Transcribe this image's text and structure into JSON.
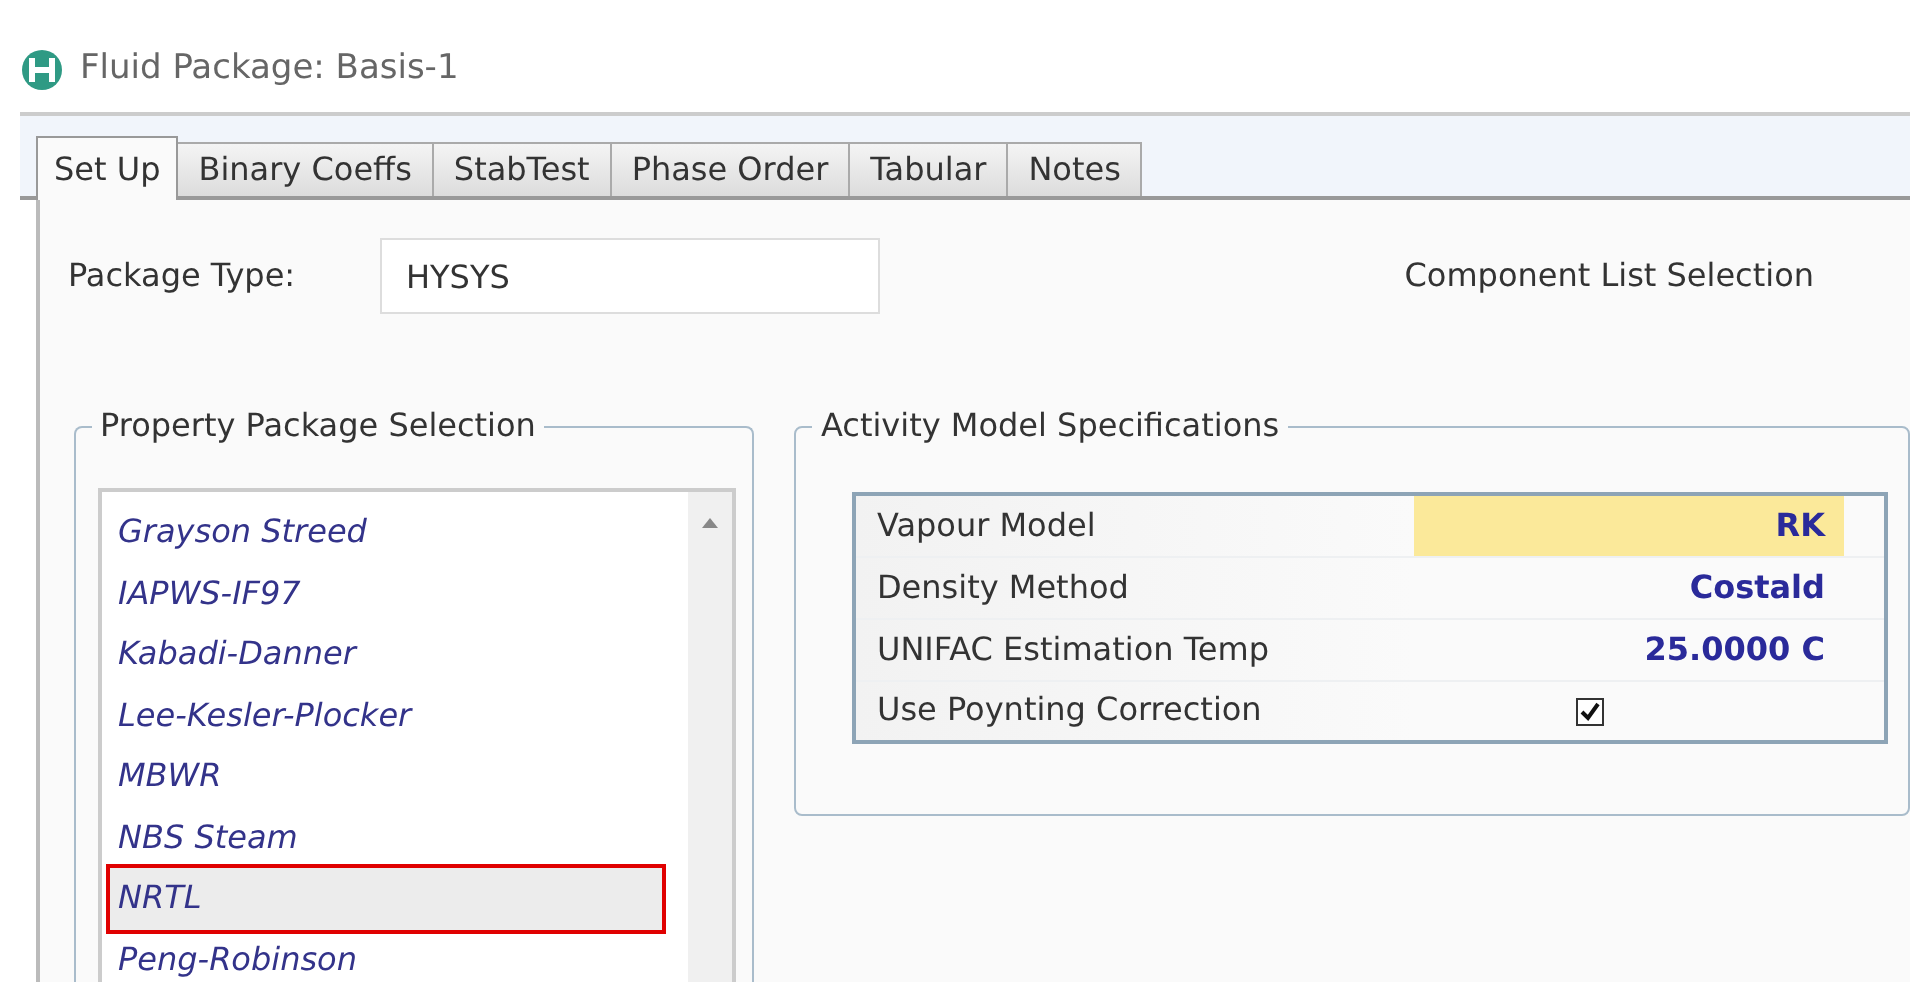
{
  "window": {
    "title": "Fluid Package: Basis-1"
  },
  "tabs": [
    {
      "label": "Set Up",
      "selected": true
    },
    {
      "label": "Binary Coeffs",
      "selected": false
    },
    {
      "label": "StabTest",
      "selected": false
    },
    {
      "label": "Phase Order",
      "selected": false
    },
    {
      "label": "Tabular",
      "selected": false
    },
    {
      "label": "Notes",
      "selected": false
    }
  ],
  "package_type": {
    "label": "Package Type:",
    "value": "HYSYS"
  },
  "component_list": {
    "label": "Component List Selection"
  },
  "property_package": {
    "title": "Property Package Selection",
    "items": [
      {
        "label": "Grayson Streed",
        "selected": false
      },
      {
        "label": "IAPWS-IF97",
        "selected": false
      },
      {
        "label": "Kabadi-Danner",
        "selected": false
      },
      {
        "label": "Lee-Kesler-Plocker",
        "selected": false
      },
      {
        "label": "MBWR",
        "selected": false
      },
      {
        "label": "NBS Steam",
        "selected": false
      },
      {
        "label": "NRTL",
        "selected": true
      },
      {
        "label": "Peng-Robinson",
        "selected": false
      }
    ]
  },
  "activity_model": {
    "title": "Activity Model Specifications",
    "rows": [
      {
        "kind": "value",
        "label": "Vapour Model",
        "value": "RK",
        "focused": true
      },
      {
        "kind": "value",
        "label": "Density Method",
        "value": "Costald",
        "focused": false
      },
      {
        "kind": "value",
        "label": "UNIFAC Estimation Temp",
        "value": "25.0000 C",
        "focused": false
      },
      {
        "kind": "checkbox",
        "label": "Use Poynting Correction",
        "checked": true
      }
    ]
  }
}
